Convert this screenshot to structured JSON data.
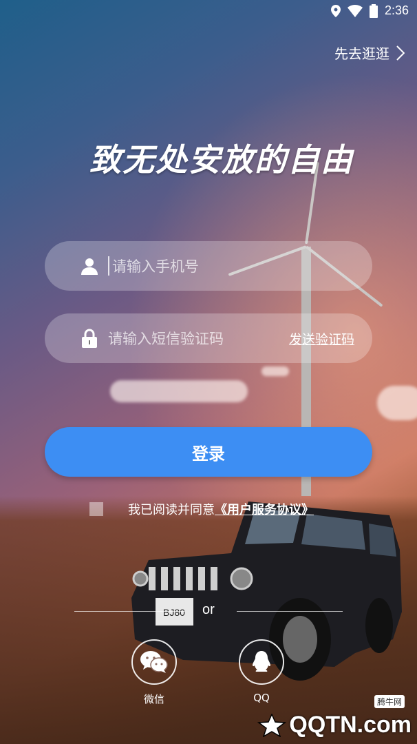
{
  "status": {
    "time": "2:36",
    "icons": [
      "location-icon",
      "wifi-icon",
      "battery-icon"
    ]
  },
  "skip_label": "先去逛逛",
  "slogan": "致无处安放的自由",
  "phone": {
    "placeholder": "请输入手机号",
    "icon": "user-icon"
  },
  "code": {
    "placeholder": "请输入短信验证码",
    "icon": "lock-icon",
    "send_label": "发送验证码"
  },
  "login_label": "登录",
  "agreement": {
    "text": "我已阅读并同意",
    "link": "《用户服务协议》",
    "checked": false
  },
  "or_label": "or",
  "social": [
    {
      "label": "微信",
      "icon": "wechat-icon"
    },
    {
      "label": "QQ",
      "icon": "qq-icon"
    }
  ],
  "watermark": {
    "text": "QQTN.com",
    "badge": "腾牛网"
  },
  "vehicle_badge": "BJ80",
  "colors": {
    "primary": "#3d8ef3",
    "text": "#ffffff"
  }
}
